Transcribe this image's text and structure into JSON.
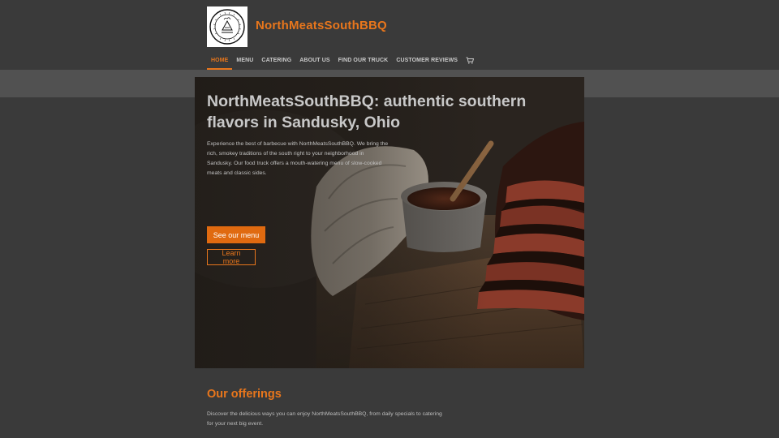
{
  "site": {
    "title": "NorthMeatsSouthBBQ"
  },
  "nav": {
    "items": [
      {
        "label": "HOME",
        "active": true
      },
      {
        "label": "MENU"
      },
      {
        "label": "CATERING"
      },
      {
        "label": "ABOUT US"
      },
      {
        "label": "FIND OUR TRUCK"
      },
      {
        "label": "CUSTOMER REVIEWS"
      }
    ],
    "cart_icon": "shopping-cart-icon"
  },
  "hero": {
    "title": "NorthMeatsSouthBBQ: authentic southern flavors in Sandusky, Ohio",
    "description": "Experience the best of barbecue with NorthMeatsSouthBBQ. We bring the rich, smokey traditions of the south right to your neighborhood in Sandusky. Our food truck offers a mouth-watering menu of slow-cooked meats and classic sides.",
    "primary_button": "See our menu",
    "secondary_button": "Learn more"
  },
  "offerings": {
    "title": "Our offerings",
    "description": "Discover the delicious ways you can enjoy NorthMeatsSouthBBQ, from daily specials to catering for your next big event."
  },
  "colors": {
    "accent": "#e8761c",
    "background": "#3a3a3a",
    "band": "#515151"
  }
}
